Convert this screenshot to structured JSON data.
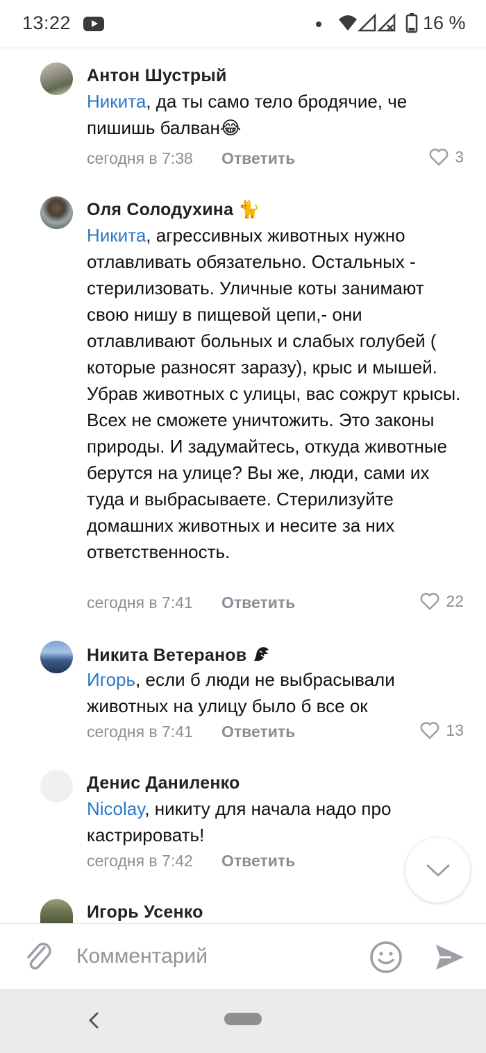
{
  "status_bar": {
    "time": "13:22",
    "battery_percent": "16 %",
    "icons": [
      "youtube-icon",
      "notification-dot-icon",
      "wifi-icon",
      "signal-icon",
      "no-signal-icon",
      "battery-icon"
    ]
  },
  "comments": [
    {
      "author": "Антон Шустрый",
      "mention": "Никита",
      "text": ", да ты само тело бродячие, че пишишь балван",
      "emoji": "😂",
      "time": "сегодня в 7:38",
      "reply_label": "Ответить",
      "likes": "3"
    },
    {
      "author": "Оля Солодухина",
      "badge": "🐈",
      "mention": "Никита",
      "text": ", агрессивных животных нужно отлавливать обязательно. Остальных - стерилизовать. Уличные коты занимают свою нишу в пищевой цепи,- они отлавливают больных и слабых голубей ( которые разносят заразу), крыс и мышей. Убрав животных с улицы, вас сожрут крысы. Всех не сможете уничтожить. Это законы природы. И задумайтесь, откуда животные берутся на улице? Вы же, люди, сами их туда и выбрасываете. Стерилизуйте домашних животных и несите за них ответственность.",
      "time": "сегодня в 7:41",
      "reply_label": "Ответить",
      "likes": "22"
    },
    {
      "author": "Никита Ветеранов",
      "mention": "Игорь",
      "text": ", если б люди не выбрасывали животных на улицу было б все ок",
      "time": "сегодня в 7:41",
      "reply_label": "Ответить",
      "likes": "13"
    },
    {
      "author": "Денис Даниленко",
      "mention": "Nicolay",
      "text": ", никиту для начала надо про кастрировать!",
      "time": "сегодня в 7:42",
      "reply_label": "Ответить"
    },
    {
      "author": "Игорь Усенко"
    }
  ],
  "composer": {
    "placeholder": "Комментарий"
  },
  "colors": {
    "mention": "#2a78c7",
    "meta": "#8a8f96",
    "icon": "#9ba0a6"
  }
}
